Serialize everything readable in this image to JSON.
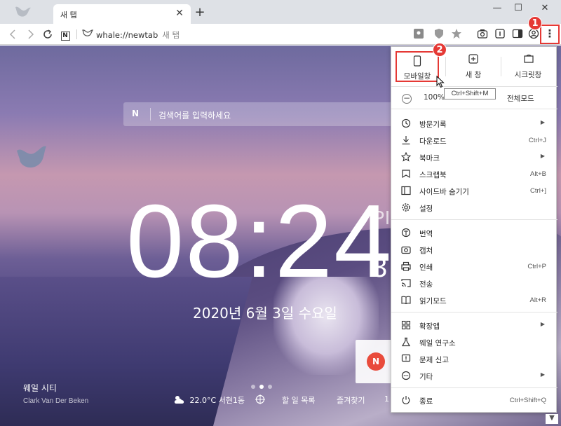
{
  "window": {
    "tab_title": "새 탭",
    "tab_close": "✕",
    "new_tab": "+",
    "minimize": "—",
    "maximize": "☐",
    "close": "✕"
  },
  "toolbar": {
    "url": "whale://newtab",
    "url_title": "새 탭",
    "menu_glyph": "⋮"
  },
  "newtab": {
    "search_logo": "N",
    "search_placeholder": "검색어를 입력하세요",
    "clock_main": "08:24",
    "clock_ampm": "PI",
    "clock_seconds": "3",
    "date": "2020년 6월 3일 수요일",
    "card_logo": "N",
    "place": "웨일 시티",
    "photographer": "Clark Van Der Beken",
    "weather_temp": "22.0°C",
    "weather_location": "서현1동",
    "todo": "할 일 목록",
    "favorites": "즐겨찾기",
    "partial_item": "1"
  },
  "menu": {
    "top_buttons": [
      {
        "label": "모바일창",
        "icon": "phone-icon"
      },
      {
        "label": "새 창",
        "icon": "new-window-icon"
      },
      {
        "label": "시크릿창",
        "icon": "secret-window-icon"
      }
    ],
    "zoom_minus": "−",
    "zoom_value": "100%",
    "fullscreen": "전체모드",
    "tooltip": "Ctrl+Shift+M",
    "group1": [
      {
        "label": "방문기록",
        "shortcut": "",
        "submenu": true,
        "icon": "history-icon"
      },
      {
        "label": "다운로드",
        "shortcut": "Ctrl+J",
        "submenu": false,
        "icon": "download-icon"
      },
      {
        "label": "북마크",
        "shortcut": "",
        "submenu": true,
        "icon": "star-icon"
      },
      {
        "label": "스크랩북",
        "shortcut": "Alt+B",
        "submenu": false,
        "icon": "scrapbook-icon"
      },
      {
        "label": "사이드바 숨기기",
        "shortcut": "Ctrl+]",
        "submenu": false,
        "icon": "sidebar-icon"
      },
      {
        "label": "설정",
        "shortcut": "",
        "submenu": false,
        "icon": "gear-icon"
      }
    ],
    "group2": [
      {
        "label": "번역",
        "shortcut": "",
        "submenu": false,
        "icon": "translate-icon"
      },
      {
        "label": "캡처",
        "shortcut": "",
        "submenu": false,
        "icon": "camera-icon"
      },
      {
        "label": "인쇄",
        "shortcut": "Ctrl+P",
        "submenu": false,
        "icon": "print-icon"
      },
      {
        "label": "전송",
        "shortcut": "",
        "submenu": false,
        "icon": "cast-icon"
      },
      {
        "label": "읽기모드",
        "shortcut": "Alt+R",
        "submenu": false,
        "icon": "book-icon"
      }
    ],
    "group3": [
      {
        "label": "확장앱",
        "shortcut": "",
        "submenu": true,
        "icon": "extensions-icon"
      },
      {
        "label": "웨일 연구소",
        "shortcut": "",
        "submenu": false,
        "icon": "flask-icon"
      },
      {
        "label": "문제 신고",
        "shortcut": "",
        "submenu": false,
        "icon": "report-icon"
      },
      {
        "label": "기타",
        "shortcut": "",
        "submenu": true,
        "icon": "more-icon"
      }
    ],
    "exit": {
      "label": "종료",
      "shortcut": "Ctrl+Shift+Q",
      "icon": "power-icon"
    }
  },
  "annotations": {
    "badge1": "1",
    "badge2": "2"
  },
  "colors": {
    "accent_red": "#e53935",
    "menu_bg": "#ffffff",
    "titlebar": "#dee1e6"
  }
}
